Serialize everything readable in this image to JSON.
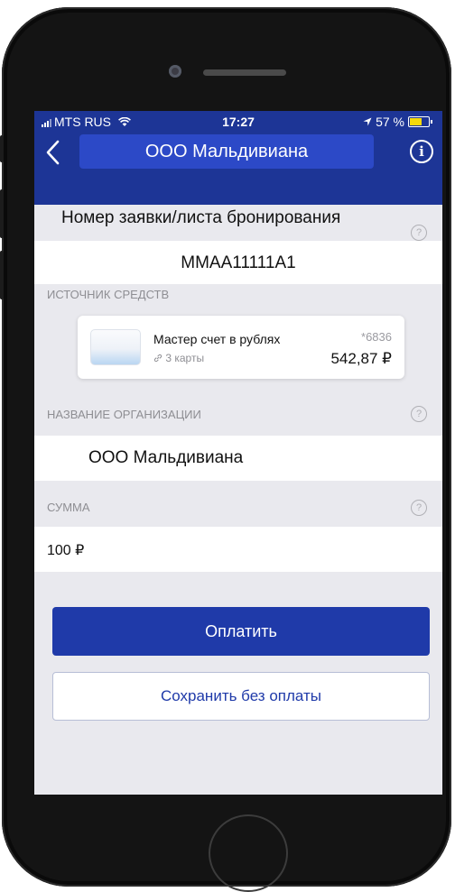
{
  "status_bar": {
    "carrier": "MTS RUS",
    "time": "17:27",
    "battery": "57 %",
    "battery_level": 0.57
  },
  "nav": {
    "title": "ООО Мальдивиана"
  },
  "booking": {
    "label": "Номер заявки/листа бронирования",
    "value": "MMAA11111A1"
  },
  "source": {
    "label": "ИСТОЧНИК СРЕДСТВ",
    "account_name": "Мастер счет в рублях",
    "cards_count": "3 карты",
    "masked_number": "*6836",
    "balance": "542,87 ₽"
  },
  "organization": {
    "label": "НАЗВАНИЕ ОРГАНИЗАЦИИ",
    "value": "ООО Мальдивиана"
  },
  "amount": {
    "label": "СУММА",
    "value": "100 ₽"
  },
  "actions": {
    "pay_label": "Оплатить",
    "save_label": "Сохранить без оплаты"
  },
  "colors": {
    "brand": "#1d3596",
    "title_highlight": "#2c49c7",
    "button": "#1f3aa9"
  }
}
